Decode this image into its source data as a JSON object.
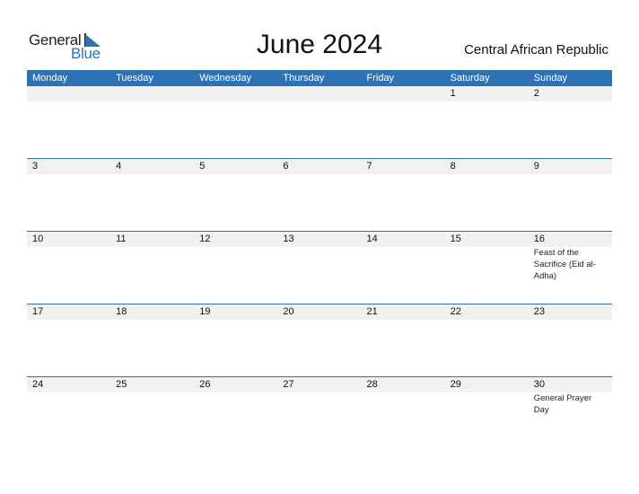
{
  "logo": {
    "word1": "General",
    "word2": "Blue"
  },
  "title": "June 2024",
  "country": "Central African Republic",
  "colors": {
    "accent": "#2e72b6",
    "strip": "#f1f1f1"
  },
  "weekdays": [
    "Monday",
    "Tuesday",
    "Wednesday",
    "Thursday",
    "Friday",
    "Saturday",
    "Sunday"
  ],
  "weeks": [
    [
      {
        "day": ""
      },
      {
        "day": ""
      },
      {
        "day": ""
      },
      {
        "day": ""
      },
      {
        "day": ""
      },
      {
        "day": "1"
      },
      {
        "day": "2"
      }
    ],
    [
      {
        "day": "3"
      },
      {
        "day": "4"
      },
      {
        "day": "5"
      },
      {
        "day": "6"
      },
      {
        "day": "7"
      },
      {
        "day": "8"
      },
      {
        "day": "9"
      }
    ],
    [
      {
        "day": "10"
      },
      {
        "day": "11"
      },
      {
        "day": "12"
      },
      {
        "day": "13"
      },
      {
        "day": "14"
      },
      {
        "day": "15"
      },
      {
        "day": "16",
        "event": "Feast of the Sacrifice (Eid al-Adha)"
      }
    ],
    [
      {
        "day": "17"
      },
      {
        "day": "18"
      },
      {
        "day": "19"
      },
      {
        "day": "20"
      },
      {
        "day": "21"
      },
      {
        "day": "22"
      },
      {
        "day": "23"
      }
    ],
    [
      {
        "day": "24"
      },
      {
        "day": "25"
      },
      {
        "day": "26"
      },
      {
        "day": "27"
      },
      {
        "day": "28"
      },
      {
        "day": "29"
      },
      {
        "day": "30",
        "event": "General Prayer Day"
      }
    ]
  ]
}
